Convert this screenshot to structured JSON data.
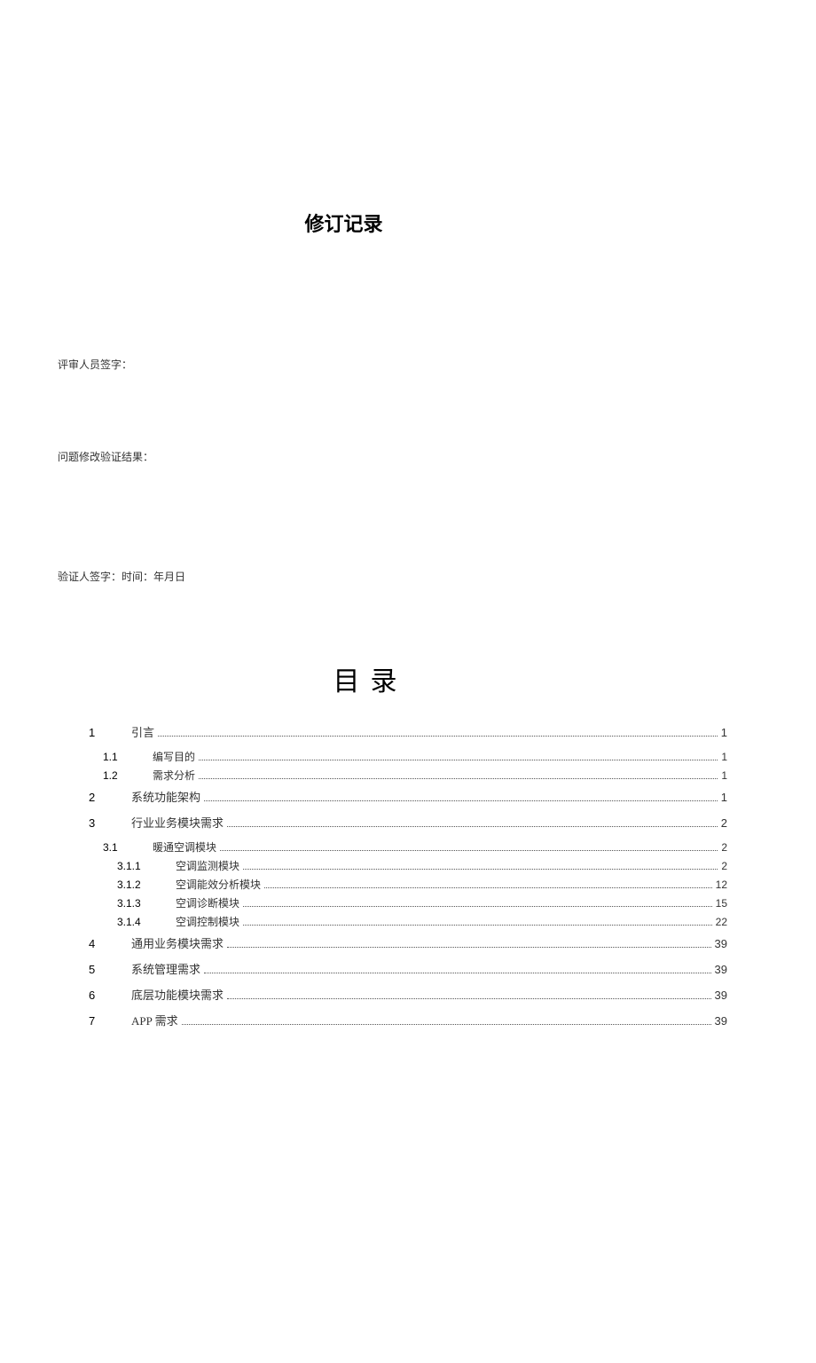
{
  "revision_title": "修订记录",
  "sign_lines": {
    "reviewer": "评审人员签字：",
    "issue_result": "问题修改验证结果：",
    "verifier": "验证人签字：时间：年月日"
  },
  "toc_title": "目录",
  "toc": [
    {
      "level": 1,
      "num": "1",
      "label": "引言",
      "page": "1"
    },
    {
      "level": 2,
      "num": "1.1",
      "label": "编写目的",
      "page": "1"
    },
    {
      "level": 2,
      "num": "1.2",
      "label": "需求分析",
      "page": "1"
    },
    {
      "level": 1,
      "num": "2",
      "label": "系统功能架构",
      "page": "1"
    },
    {
      "level": 1,
      "num": "3",
      "label": "行业业务模块需求",
      "page": "2"
    },
    {
      "level": 2,
      "num": "3.1",
      "label": "暖通空调模块",
      "page": "2"
    },
    {
      "level": 3,
      "num": "3.1.1",
      "label": "空调监测模块",
      "page": "2"
    },
    {
      "level": 3,
      "num": "3.1.2",
      "label": "空调能效分析模块",
      "page": "12"
    },
    {
      "level": 3,
      "num": "3.1.3",
      "label": "空调诊断模块",
      "page": "15"
    },
    {
      "level": 3,
      "num": "3.1.4",
      "label": "空调控制模块",
      "page": "22"
    },
    {
      "level": 1,
      "num": "4",
      "label": "通用业务模块需求",
      "page": "39"
    },
    {
      "level": 1,
      "num": "5",
      "label": "系统管理需求",
      "page": "39"
    },
    {
      "level": 1,
      "num": "6",
      "label": "底层功能模块需求",
      "page": "39"
    },
    {
      "level": 1,
      "num": "7",
      "label": "APP 需求",
      "page": "39"
    }
  ]
}
